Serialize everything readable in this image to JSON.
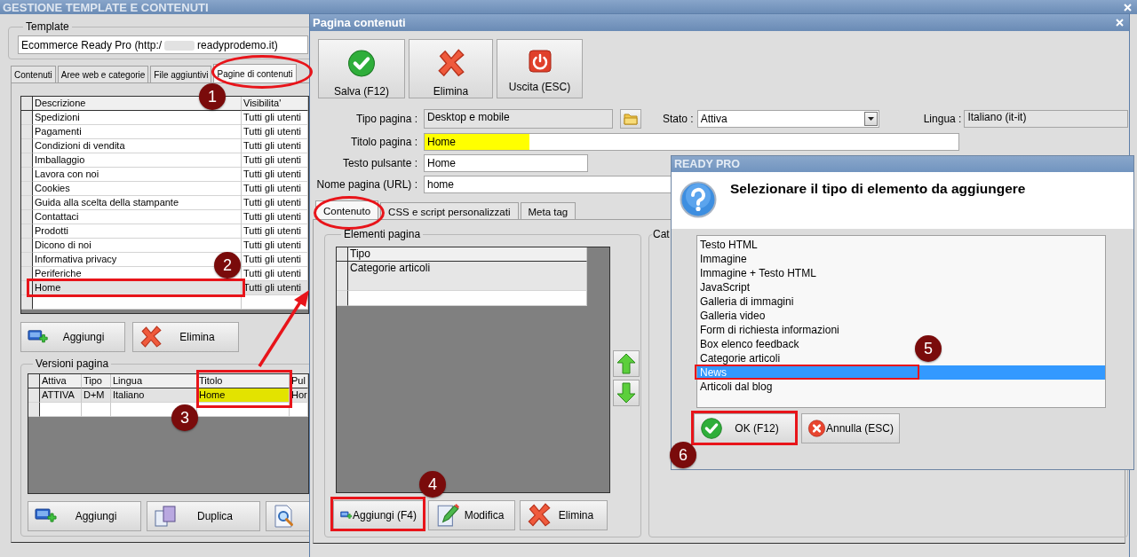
{
  "main_window": {
    "title": "GESTIONE TEMPLATE E CONTENUTI",
    "template": {
      "label": "Template",
      "value_start": "Ecommerce Ready Pro (http:/",
      "value_end": "readyprodemo.it)"
    },
    "tabs": [
      {
        "label": "Contenuti",
        "selected": false
      },
      {
        "label": "Aree web e categorie",
        "selected": false
      },
      {
        "label": "File aggiuntivi",
        "selected": false
      },
      {
        "label": "Pagine di contenuti",
        "selected": true
      }
    ],
    "pages_table": {
      "columns": [
        "Descrizione",
        "Visibilita'"
      ],
      "rows": [
        {
          "cells": [
            "Spedizioni",
            "Tutti gli utenti"
          ],
          "selected": false
        },
        {
          "cells": [
            "Pagamenti",
            "Tutti gli utenti"
          ],
          "selected": false
        },
        {
          "cells": [
            "Condizioni di vendita",
            "Tutti gli utenti"
          ],
          "selected": false
        },
        {
          "cells": [
            "Imballaggio",
            "Tutti gli utenti"
          ],
          "selected": false
        },
        {
          "cells": [
            "Lavora con noi",
            "Tutti gli utenti"
          ],
          "selected": false
        },
        {
          "cells": [
            "Cookies",
            "Tutti gli utenti"
          ],
          "selected": false
        },
        {
          "cells": [
            "Guida alla scelta della stampante",
            "Tutti gli utenti"
          ],
          "selected": false
        },
        {
          "cells": [
            "Contattaci",
            "Tutti gli utenti"
          ],
          "selected": false
        },
        {
          "cells": [
            "Prodotti",
            "Tutti gli utenti"
          ],
          "selected": false
        },
        {
          "cells": [
            "Dicono di noi",
            "Tutti gli utenti"
          ],
          "selected": false
        },
        {
          "cells": [
            "Informativa privacy",
            "Tutti gli utenti"
          ],
          "selected": false
        },
        {
          "cells": [
            "Periferiche",
            "Tutti gli utenti"
          ],
          "selected": false
        },
        {
          "cells": [
            "Home",
            "Tutti gli utenti"
          ],
          "selected": true
        }
      ]
    },
    "buttons": [
      {
        "kind": "add",
        "label": "Aggiungi"
      },
      {
        "kind": "delete",
        "label": "Elimina"
      }
    ],
    "versions": {
      "label": "Versioni pagina",
      "columns": [
        "Attiva",
        "Tipo",
        "Lingua",
        "Titolo",
        "Pul"
      ],
      "rows": [
        {
          "selected": true,
          "cells": [
            {
              "text": "ATTIVA",
              "highlighted": false
            },
            {
              "text": "D+M",
              "highlighted": false
            },
            {
              "text": "Italiano",
              "highlighted": false
            },
            {
              "text": "Home",
              "highlighted": true
            },
            {
              "text": "Hor",
              "highlighted": false
            }
          ]
        }
      ],
      "buttons": [
        {
          "kind": "add",
          "label": "Aggiungi"
        },
        {
          "kind": "duplicate",
          "label": "Duplica"
        },
        {
          "kind": "preview"
        }
      ]
    }
  },
  "content_window": {
    "title": "Pagina contenuti",
    "toolbar": [
      {
        "kind": "save",
        "label": "Salva (F12)"
      },
      {
        "kind": "delete",
        "label": "Elimina"
      },
      {
        "kind": "exit",
        "label": "Uscita (ESC)"
      }
    ],
    "page_type": {
      "label": "Tipo pagina :",
      "value": "Desktop e mobile"
    },
    "status": {
      "label": "Stato :",
      "value": "Attiva"
    },
    "language": {
      "label": "Lingua :",
      "value": "Italiano (it-it)"
    },
    "page_title": {
      "label": "Titolo pagina :",
      "value": "Home",
      "highlighted": true
    },
    "button_text": {
      "label": "Testo pulsante :",
      "value": "Home"
    },
    "page_name": {
      "label": "Nome pagina (URL) :",
      "value": "home"
    },
    "tabs": [
      {
        "label": "Contenuto",
        "selected": true
      },
      {
        "label": "CSS e script personalizzati",
        "selected": false
      },
      {
        "label": "Meta tag",
        "selected": false
      }
    ],
    "elements": {
      "label": "Elementi pagina",
      "columns": [
        "Tipo"
      ],
      "rows": [
        "Categorie articoli"
      ],
      "buttons": [
        {
          "kind": "add",
          "label": "Aggiungi (F4)"
        },
        {
          "kind": "edit",
          "label": "Modifica"
        },
        {
          "kind": "delete",
          "label": "Elimina"
        }
      ]
    },
    "side_group": {
      "label": "Cat"
    }
  },
  "dialog": {
    "title": "READY PRO",
    "message": "Selezionare il tipo di elemento da aggiungere",
    "items": [
      {
        "label": "Testo HTML",
        "selected": false
      },
      {
        "label": "Immagine",
        "selected": false
      },
      {
        "label": "Immagine + Testo HTML",
        "selected": false
      },
      {
        "label": "JavaScript",
        "selected": false
      },
      {
        "label": "Galleria di immagini",
        "selected": false
      },
      {
        "label": "Galleria video",
        "selected": false
      },
      {
        "label": "Form di richiesta informazioni",
        "selected": false
      },
      {
        "label": "Box elenco feedback",
        "selected": false
      },
      {
        "label": "Categorie articoli",
        "selected": false
      },
      {
        "label": "News",
        "selected": true
      },
      {
        "label": "Articoli dal blog",
        "selected": false
      }
    ],
    "buttons": [
      {
        "kind": "ok",
        "label": "OK (F12)"
      },
      {
        "kind": "cancel",
        "label": "Annulla (ESC)"
      }
    ]
  },
  "annotations": [
    {
      "number": "1"
    },
    {
      "number": "2"
    },
    {
      "number": "3"
    },
    {
      "number": "4"
    },
    {
      "number": "5"
    },
    {
      "number": "6"
    }
  ]
}
